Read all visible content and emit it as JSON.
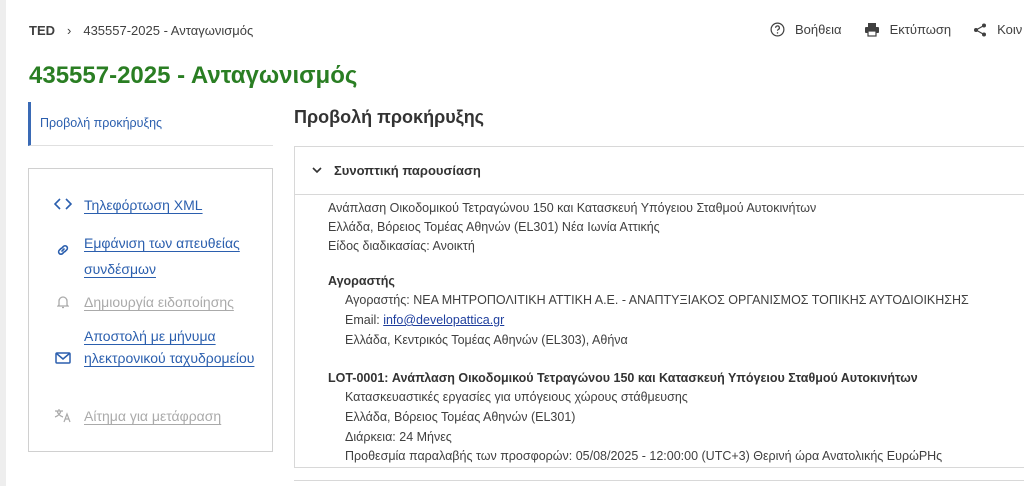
{
  "breadcrumb": {
    "root": "TED",
    "separator": "›",
    "current": "435557-2025 - Ανταγωνισμός"
  },
  "toolbar": {
    "help": "Βοήθεια",
    "print": "Εκτύπωση",
    "share": "Κοιν"
  },
  "page": {
    "title": "435557-2025 - Ανταγωνισμός"
  },
  "nav": {
    "active_tab": "Προβολή προκήρυξης"
  },
  "actions": [
    {
      "label": "Τηλεφόρτωση XML",
      "icon": "code-icon",
      "enabled": true
    },
    {
      "label": "Εμφάνιση των απευθείας συνδέσμων",
      "icon": "link-icon",
      "enabled": true
    },
    {
      "label": "Δημιουργία ειδοποίησης",
      "icon": "bell-icon",
      "enabled": false
    },
    {
      "label": "Αποστολή με μήνυμα ηλεκτρονικού ταχυδρομείου",
      "icon": "mail-icon",
      "enabled": true
    },
    {
      "label": "Αίτημα για μετάφραση",
      "icon": "translate-icon",
      "enabled": false
    }
  ],
  "main": {
    "section_title": "Προβολή προκήρυξης",
    "panel_title": "Συνοπτική παρουσίαση",
    "summary": {
      "project_line": "Ανάπλαση Οικοδομικού Τετραγώνου 150 και Κατασκευή Υπόγειου Σταθμού Αυτοκινήτων",
      "location_line": "Ελλάδα, Βόρειος Τομέας Αθηνών (EL301) Νέα Ιωνία Αττικής",
      "procedure_line": "Είδος διαδικασίας: Ανοικτή"
    },
    "buyer": {
      "heading": "Αγοραστής",
      "name_line": "Αγοραστής: ΝΕΑ ΜΗΤΡΟΠΟΛΙΤΙΚΗ ΑΤΤΙΚΗ Α.Ε. - ΑΝΑΠΤΥΞΙΑΚΟΣ ΟΡΓΑΝΙΣΜΟΣ ΤΟΠΙΚΗΣ ΑΥΤΟΔΙΟΙΚΗΣΗΣ",
      "email_label": "Email: ",
      "email": "info@developattica.gr",
      "address_line": "Ελλάδα, Κεντρικός Τομέας Αθηνών (EL303), Αθήνα"
    },
    "lot": {
      "heading": "LOT-0001: Ανάπλαση Οικοδομικού Τετραγώνου 150 και Κατασκευή Υπόγειου Σταθμού Αυτοκινήτων",
      "works_line": "Κατασκευαστικές εργασίες για υπόγειους χώρους στάθμευσης",
      "region_line": "Ελλάδα, Βόρειος Τομέας Αθηνών (EL301)",
      "duration_line": "Διάρκεια: 24 Μήνες",
      "deadline_line": "Προθεσμία παραλαβής των προσφορών: 05/08/2025 - 12:00:00 (UTC+3) Θερινή ώρα Ανατολικής ΕυρώΡΗς"
    }
  }
}
